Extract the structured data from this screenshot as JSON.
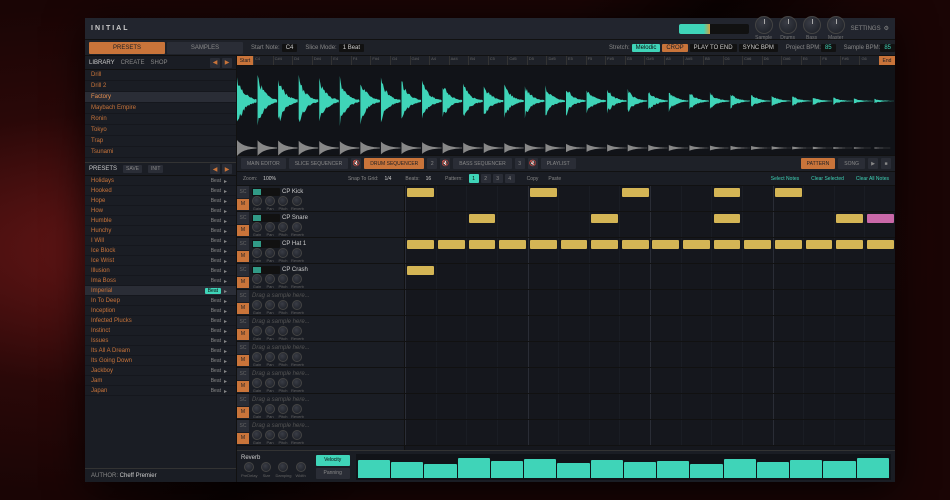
{
  "brand": "INITIAL",
  "top_knobs": [
    {
      "label": "Sample"
    },
    {
      "label": "Drums"
    },
    {
      "label": "Bass"
    },
    {
      "label": "Master"
    }
  ],
  "settings_label": "SETTINGS",
  "tabs": {
    "presets": "PRESETS",
    "samples": "SAMPLES"
  },
  "params": {
    "start_note_label": "Start Note:",
    "start_note": "C4",
    "slice_mode_label": "Slice Mode:",
    "slice_mode": "1 Beat",
    "stretch_label": "Stretch:",
    "stretch_mode": "Melodic",
    "crop": "CROP",
    "play_to_end": "PLAY TO END",
    "sync_bpm": "SYNC BPM",
    "project_bpm_label": "Project BPM:",
    "project_bpm": "85",
    "sample_bpm_label": "Sample BPM:",
    "sample_bpm": "85"
  },
  "ruler": {
    "start": "Start",
    "end": "End",
    "ticks": [
      "C4",
      "C#4",
      "D4",
      "D#4",
      "E4",
      "F4",
      "F#4",
      "G4",
      "G#4",
      "A4",
      "A#4",
      "B4",
      "C5",
      "C#5",
      "D5",
      "D#5",
      "E5",
      "F5",
      "F#5",
      "G5",
      "G#5",
      "A5",
      "A#5",
      "B5",
      "C6",
      "C#6",
      "D6",
      "D#6",
      "E6",
      "F6",
      "F#6",
      "G6"
    ]
  },
  "sidebar": {
    "library_label": "LIBRARY",
    "create_label": "CREATE",
    "shop_label": "SHOP",
    "categories": [
      "Drill",
      "Drill 2",
      "Factory",
      "Maybach Empire",
      "Ronin",
      "Tokyo",
      "Trap",
      "Tsunami"
    ],
    "selected_category_index": 2,
    "presets_label": "PRESETS",
    "save": "SAVE",
    "init": "INIT",
    "presets": [
      {
        "name": "Holidays",
        "tag": "Beat"
      },
      {
        "name": "Hooked",
        "tag": "Beat"
      },
      {
        "name": "Hope",
        "tag": "Beat"
      },
      {
        "name": "How",
        "tag": "Beat"
      },
      {
        "name": "Humble",
        "tag": "Beat"
      },
      {
        "name": "Hunchy",
        "tag": "Beat"
      },
      {
        "name": "I Will",
        "tag": "Beat"
      },
      {
        "name": "Ice Block",
        "tag": "Beat"
      },
      {
        "name": "Ice Wrist",
        "tag": "Beat"
      },
      {
        "name": "Illusion",
        "tag": "Beat"
      },
      {
        "name": "Ima Boss",
        "tag": "Beat"
      },
      {
        "name": "Imperial",
        "tag": "Beat"
      },
      {
        "name": "In To Deep",
        "tag": "Beat"
      },
      {
        "name": "Inception",
        "tag": "Beat"
      },
      {
        "name": "Infected Plucks",
        "tag": "Beat"
      },
      {
        "name": "Instinct",
        "tag": "Beat"
      },
      {
        "name": "Issues",
        "tag": "Beat"
      },
      {
        "name": "Its All A Dream",
        "tag": "Beat"
      },
      {
        "name": "Its Going Down",
        "tag": "Beat"
      },
      {
        "name": "Jackboy",
        "tag": "Beat"
      },
      {
        "name": "Jam",
        "tag": "Beat"
      },
      {
        "name": "Japan",
        "tag": "Beat"
      }
    ],
    "selected_preset_index": 11,
    "author_label": "AUTHOR:",
    "author": "Cheff Premier"
  },
  "editor_tabs": {
    "main": "MAIN EDITOR",
    "slice": "SLICE SEQUENCER",
    "drum": "DRUM SEQUENCER",
    "bass": "BASS SEQUENCER",
    "playlist": "PLAYLIST",
    "pattern": "PATTERN",
    "song": "SONG"
  },
  "seq_toolbar": {
    "zoom_label": "Zoom:",
    "zoom": "100%",
    "snap_label": "Snap To Grid:",
    "snap": "1/4",
    "beats_label": "Beats:",
    "beats": "16",
    "pattern_label": "Pattern:",
    "patterns": [
      "1",
      "2",
      "3",
      "4"
    ],
    "copy": "Copy",
    "paste": "Paste",
    "select_notes": "Select Notes",
    "clear_selected": "Clear Selected",
    "clear_all": "Clear All Notes"
  },
  "tracks": [
    {
      "name": "CP Kick",
      "empty": false,
      "notes": [
        0,
        4,
        7,
        10,
        12
      ]
    },
    {
      "name": "CP Snare",
      "empty": false,
      "notes": [
        2,
        6,
        10,
        14,
        "pink:15"
      ]
    },
    {
      "name": "CP Hat 1",
      "empty": false,
      "notes": [
        0,
        1,
        2,
        3,
        4,
        5,
        6,
        7,
        8,
        9,
        10,
        11,
        12,
        13,
        14,
        15
      ]
    },
    {
      "name": "CP Crash",
      "empty": false,
      "notes": [
        0
      ]
    },
    {
      "name": "Drag a sample here...",
      "empty": true,
      "notes": []
    },
    {
      "name": "Drag a sample here...",
      "empty": true,
      "notes": []
    },
    {
      "name": "Drag a sample here...",
      "empty": true,
      "notes": []
    },
    {
      "name": "Drag a sample here...",
      "empty": true,
      "notes": []
    },
    {
      "name": "Drag a sample here...",
      "empty": true,
      "notes": []
    },
    {
      "name": "Drag a sample here...",
      "empty": true,
      "notes": []
    }
  ],
  "track_params": [
    "Gain",
    "Pan",
    "Pitch",
    "Reverb"
  ],
  "reverb": {
    "label": "Reverb",
    "params": [
      "PreDelay",
      "Size",
      "Damping",
      "Width"
    ],
    "velocity": "Velocity",
    "panning": "Panning",
    "velocity_bars": [
      80,
      70,
      60,
      90,
      75,
      85,
      65,
      80,
      70,
      75,
      60,
      85,
      70,
      80,
      75,
      90
    ]
  }
}
